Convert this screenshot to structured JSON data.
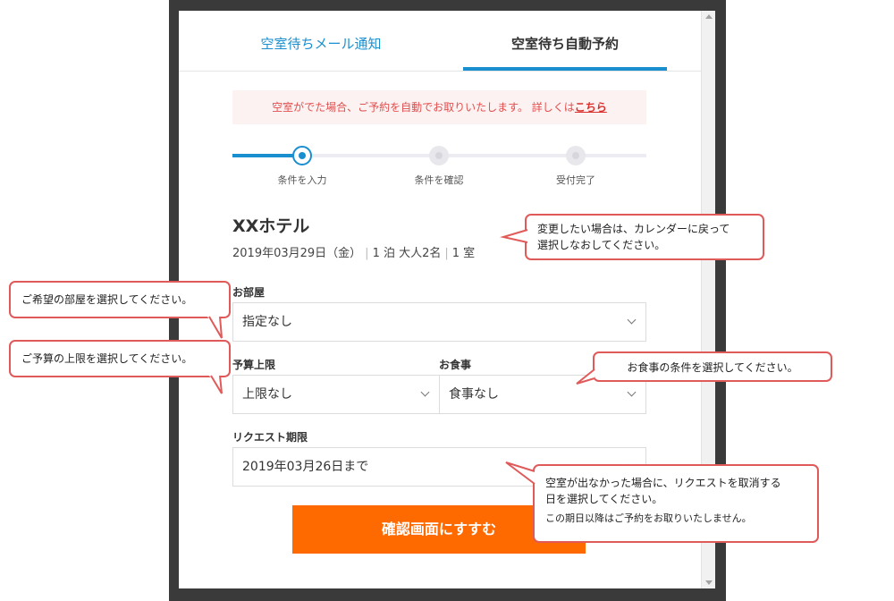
{
  "tabs": [
    {
      "label": "空室待ちメール通知"
    },
    {
      "label": "空室待ち自動予約"
    }
  ],
  "notice": {
    "text": "空室がでた場合、ご予約を自動でお取りいたします。 詳しくは",
    "link": "こちら"
  },
  "steps": [
    {
      "label": "条件を入力"
    },
    {
      "label": "条件を確認"
    },
    {
      "label": "受付完了"
    }
  ],
  "hotel": {
    "name": "XXホテル",
    "date": "2019年03月29日（金）",
    "nights": "1 泊",
    "guests": "大人2名",
    "rooms": "1 室"
  },
  "form": {
    "room_label": "お部屋",
    "room_value": "指定なし",
    "budget_label": "予算上限",
    "budget_value": "上限なし",
    "meal_label": "お食事",
    "meal_value": "食事なし",
    "deadline_label": "リクエスト期限",
    "deadline_value": "2019年03月26日まで",
    "submit_label": "確認画面にすすむ"
  },
  "callouts": {
    "calendar_line1": "変更したい場合は、カレンダーに戻って",
    "calendar_line2": "選択しなおしてください。",
    "room": "ご希望の部屋を選択してください。",
    "budget": "ご予算の上限を選択してください。",
    "meal": "お食事の条件を選択してください。",
    "deadline_line1": "空室が出なかった場合に、リクエストを取消する",
    "deadline_line2": "日を選択してください。",
    "deadline_line3": "この期日以降はご予約をお取りいたしません。"
  },
  "colors": {
    "accent_blue": "#1a8fd0",
    "button_orange": "#ff6a00",
    "notice_red": "#e0504f",
    "callout_border": "#e15a5a"
  }
}
